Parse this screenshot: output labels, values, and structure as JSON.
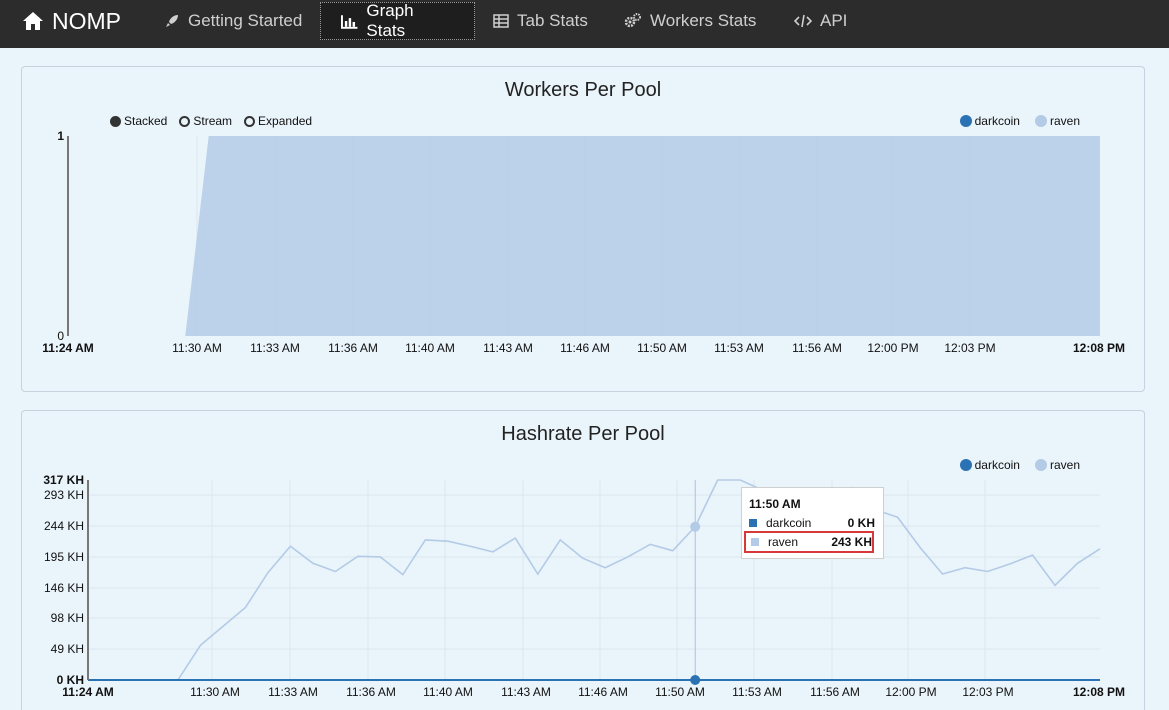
{
  "nav": {
    "brand": "NOMP",
    "items": [
      {
        "label": "Getting Started",
        "icon": "rocket-icon"
      },
      {
        "label": "Graph Stats",
        "icon": "bar-chart-icon",
        "active": true
      },
      {
        "label": "Tab Stats",
        "icon": "table-icon"
      },
      {
        "label": "Workers Stats",
        "icon": "gears-icon"
      },
      {
        "label": "API",
        "icon": "code-icon"
      }
    ]
  },
  "colors": {
    "darkcoin": "#2b72b5",
    "raven": "#b3cbe6",
    "accent_highlight": "#d9383a"
  },
  "workers_panel": {
    "title": "Workers Per Pool",
    "controls": [
      {
        "label": "Stacked",
        "selected": true
      },
      {
        "label": "Stream",
        "selected": false
      },
      {
        "label": "Expanded",
        "selected": false
      }
    ],
    "legend": [
      "darkcoin",
      "raven"
    ]
  },
  "hashrate_panel": {
    "title": "Hashrate Per Pool",
    "legend": [
      "darkcoin",
      "raven"
    ],
    "tooltip": {
      "time": "11:50 AM",
      "rows": [
        {
          "name": "darkcoin",
          "value": "0 KH"
        },
        {
          "name": "raven",
          "value": "243 KH",
          "highlighted": true
        }
      ]
    }
  },
  "chart_data": [
    {
      "type": "area",
      "title": "Workers Per Pool",
      "x_start": "11:24 AM",
      "x_end": "12:08 PM",
      "x_tick_labels": [
        "11:30 AM",
        "11:33 AM",
        "11:36 AM",
        "11:40 AM",
        "11:43 AM",
        "11:46 AM",
        "11:50 AM",
        "11:53 AM",
        "11:56 AM",
        "12:00 PM",
        "12:03 PM"
      ],
      "y_tick_labels": [
        "0",
        "1"
      ],
      "ylim": [
        0,
        1
      ],
      "stacked": true,
      "legend": "top-right",
      "series": [
        {
          "name": "darkcoin",
          "values": [
            0,
            0,
            0,
            0,
            0,
            0,
            0,
            0,
            0,
            0,
            0,
            0,
            0,
            0,
            0,
            0,
            0,
            0,
            0,
            0,
            0,
            0,
            0,
            0,
            0,
            0,
            0,
            0,
            0,
            0,
            0,
            0,
            0,
            0,
            0,
            0,
            0,
            0,
            0,
            0,
            0,
            0,
            0,
            0,
            0
          ]
        },
        {
          "name": "raven",
          "values": [
            0,
            0,
            0,
            0,
            0,
            0,
            1,
            1,
            1,
            1,
            1,
            1,
            1,
            1,
            1,
            1,
            1,
            1,
            1,
            1,
            1,
            1,
            1,
            1,
            1,
            1,
            1,
            1,
            1,
            1,
            1,
            1,
            1,
            1,
            1,
            1,
            1,
            1,
            1,
            1,
            1,
            1,
            1,
            1,
            1
          ]
        }
      ]
    },
    {
      "type": "line",
      "title": "Hashrate Per Pool",
      "x_start": "11:24 AM",
      "x_end": "12:08 PM",
      "x_tick_labels": [
        "11:30 AM",
        "11:33 AM",
        "11:36 AM",
        "11:40 AM",
        "11:43 AM",
        "11:46 AM",
        "11:50 AM",
        "11:53 AM",
        "11:56 AM",
        "12:00 PM",
        "12:03 PM"
      ],
      "y_tick_labels": [
        "0 KH",
        "49 KH",
        "98 KH",
        "146 KH",
        "195 KH",
        "244 KH",
        "293 KH",
        "317 KH"
      ],
      "ylim": [
        0,
        317
      ],
      "grid": true,
      "legend": "top-right",
      "series": [
        {
          "name": "darkcoin",
          "values": [
            0,
            0,
            0,
            0,
            0,
            0,
            0,
            0,
            0,
            0,
            0,
            0,
            0,
            0,
            0,
            0,
            0,
            0,
            0,
            0,
            0,
            0,
            0,
            0,
            0,
            0,
            0,
            0,
            0,
            0,
            0,
            0,
            0,
            0,
            0,
            0,
            0,
            0,
            0,
            0,
            0,
            0,
            0,
            0,
            0,
            0,
            0,
            0
          ]
        },
        {
          "name": "raven",
          "values": [
            0,
            0,
            0,
            0,
            0,
            55,
            85,
            115,
            170,
            212,
            185,
            172,
            196,
            195,
            167,
            222,
            220,
            212,
            203,
            225,
            168,
            222,
            193,
            178,
            195,
            215,
            205,
            243,
            317,
            317,
            301,
            280,
            290,
            295,
            305,
            270,
            258,
            210,
            168,
            178,
            172,
            184,
            198,
            150,
            185,
            208
          ]
        }
      ]
    }
  ]
}
